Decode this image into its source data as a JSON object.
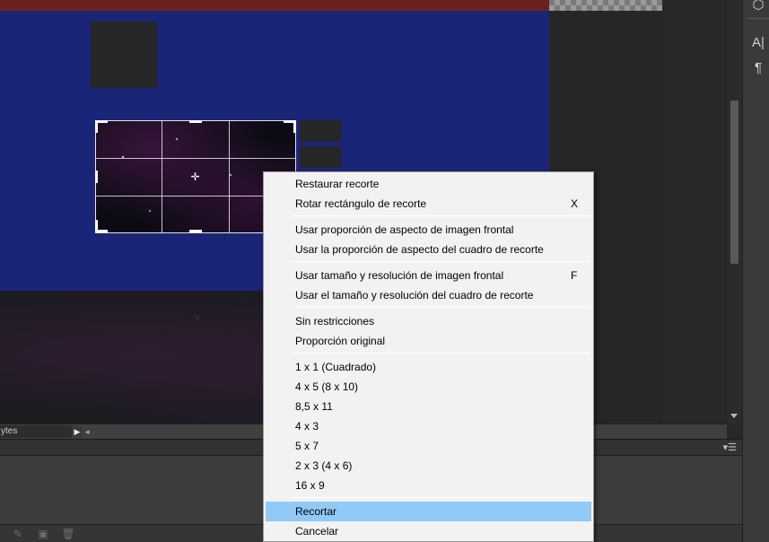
{
  "status_bar": {
    "doc_info": "ytes",
    "arrow_icon": "play-right-icon",
    "left_arrow_icon": "arrow-left-icon"
  },
  "right_panel": {
    "buttons": [
      {
        "icon": "3d-cube-icon",
        "label": "⬡"
      },
      {
        "icon": "character-icon",
        "label": "A|"
      },
      {
        "icon": "paragraph-icon",
        "label": "¶"
      }
    ]
  },
  "panel": {
    "menu_icon": "panel-menu-icon",
    "menu_glyph": "▾☰"
  },
  "footer": {
    "icons": [
      "brush-icon",
      "new-layer-icon",
      "trash-icon"
    ]
  },
  "context_menu": {
    "items": [
      {
        "label": "Restaurar recorte",
        "shortcut": ""
      },
      {
        "label": "Rotar rectángulo de recorte",
        "shortcut": "X"
      },
      {
        "label": "Usar proporción de aspecto de imagen frontal",
        "shortcut": ""
      },
      {
        "label": "Usar la proporción de aspecto del cuadro de recorte",
        "shortcut": ""
      },
      {
        "label": "Usar tamaño y resolución de imagen frontal",
        "shortcut": "F"
      },
      {
        "label": "Usar el tamaño y resolución del cuadro de recorte",
        "shortcut": ""
      },
      {
        "label": "Sin restricciones",
        "shortcut": ""
      },
      {
        "label": "Proporción original",
        "shortcut": ""
      },
      {
        "label": "1 x 1 (Cuadrado)",
        "shortcut": ""
      },
      {
        "label": "4 x 5 (8 x 10)",
        "shortcut": ""
      },
      {
        "label": "8,5 x 11",
        "shortcut": ""
      },
      {
        "label": "4 x 3",
        "shortcut": ""
      },
      {
        "label": "5 x 7",
        "shortcut": ""
      },
      {
        "label": "2 x 3 (4 x 6)",
        "shortcut": ""
      },
      {
        "label": "16 x 9",
        "shortcut": ""
      },
      {
        "label": "Recortar",
        "shortcut": "",
        "highlighted": true
      },
      {
        "label": "Cancelar",
        "shortcut": ""
      }
    ]
  },
  "colors": {
    "document_blue": "#1b2577",
    "header_red": "#6e2020",
    "menu_highlight": "#91c9f7",
    "menu_bg": "#f2f2f2"
  }
}
